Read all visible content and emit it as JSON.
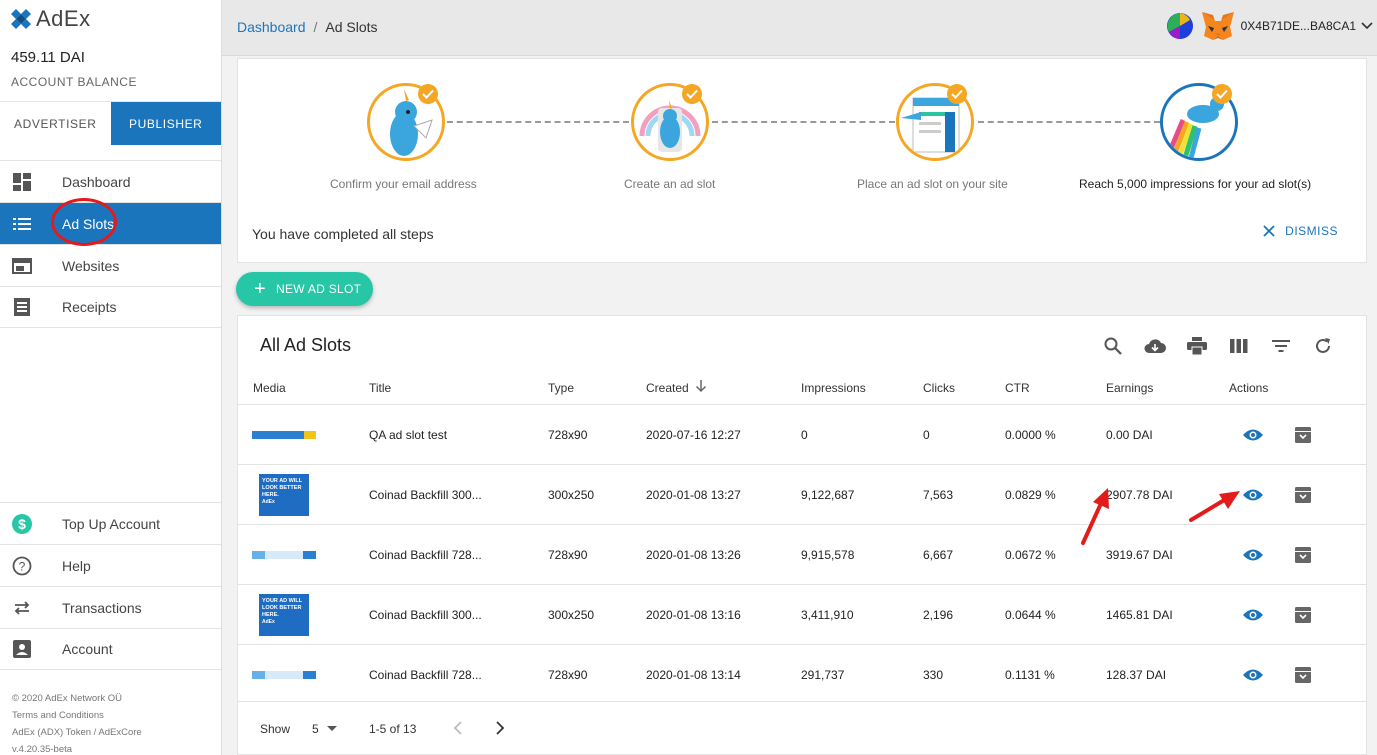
{
  "app": {
    "logo_text": "AdEx"
  },
  "account": {
    "balance": "459.11 DAI",
    "balance_label": "ACCOUNT BALANCE",
    "address": "0X4B71DE...BA8CA1"
  },
  "role_tabs": [
    "ADVERTISER",
    "PUBLISHER"
  ],
  "nav": {
    "main": [
      {
        "label": "Dashboard",
        "icon": "dashboard-icon"
      },
      {
        "label": "Ad Slots",
        "icon": "list-icon",
        "active": true
      },
      {
        "label": "Websites",
        "icon": "web-icon"
      },
      {
        "label": "Receipts",
        "icon": "receipt-icon"
      }
    ],
    "bottom": [
      {
        "label": "Top Up Account",
        "icon": "dollar-icon"
      },
      {
        "label": "Help",
        "icon": "help-icon"
      },
      {
        "label": "Transactions",
        "icon": "swap-icon"
      },
      {
        "label": "Account",
        "icon": "account-icon"
      }
    ]
  },
  "footer": {
    "line1": "© 2020 AdEx Network OÜ",
    "line2": "Terms and Conditions",
    "line3": "AdEx (ADX) Token / AdExCore",
    "line4": "v.4.20.35-beta"
  },
  "breadcrumb": {
    "parent": "Dashboard",
    "separator": "/",
    "current": "Ad Slots"
  },
  "onboarding": {
    "steps": [
      "Confirm your email address",
      "Create an ad slot",
      "Place an ad slot on your site",
      "Reach 5,000 impressions for your ad slot(s)"
    ],
    "completed_message": "You have completed all steps",
    "dismiss_label": "DISMISS"
  },
  "new_button": {
    "label": "NEW AD SLOT"
  },
  "table": {
    "title": "All Ad Slots",
    "columns": [
      "Media",
      "Title",
      "Type",
      "Created",
      "Impressions",
      "Clicks",
      "CTR",
      "Earnings",
      "Actions"
    ],
    "rows": [
      {
        "media": "wide",
        "title": "QA ad slot test",
        "type": "728x90",
        "created": "2020-07-16 12:27",
        "impressions": "0",
        "clicks": "0",
        "ctr": "0.0000 %",
        "earnings": "0.00 DAI"
      },
      {
        "media": "box",
        "title": "Coinad Backfill 300...",
        "type": "300x250",
        "created": "2020-01-08 13:27",
        "impressions": "9,122,687",
        "clicks": "7,563",
        "ctr": "0.0829 %",
        "earnings": "2907.78 DAI"
      },
      {
        "media": "wide-light",
        "title": "Coinad Backfill 728...",
        "type": "728x90",
        "created": "2020-01-08 13:26",
        "impressions": "9,915,578",
        "clicks": "6,667",
        "ctr": "0.0672 %",
        "earnings": "3919.67 DAI"
      },
      {
        "media": "box",
        "title": "Coinad Backfill 300...",
        "type": "300x250",
        "created": "2020-01-08 13:16",
        "impressions": "3,411,910",
        "clicks": "2,196",
        "ctr": "0.0644 %",
        "earnings": "1465.81 DAI"
      },
      {
        "media": "wide-light",
        "title": "Coinad Backfill 728...",
        "type": "728x90",
        "created": "2020-01-08 13:14",
        "impressions": "291,737",
        "clicks": "330",
        "ctr": "0.1131 %",
        "earnings": "128.37 DAI"
      }
    ],
    "ad_text": "YOUR AD WILL LOOK BETTER HERE.",
    "ad_brand": "AdEx",
    "pager": {
      "show_label": "Show",
      "per_page": "5",
      "range": "1-5 of 13"
    }
  },
  "colors": {
    "primary": "#1b75bc",
    "accent": "#26c6a6",
    "check": "#f5a623",
    "annotation": "#e31b1b"
  }
}
